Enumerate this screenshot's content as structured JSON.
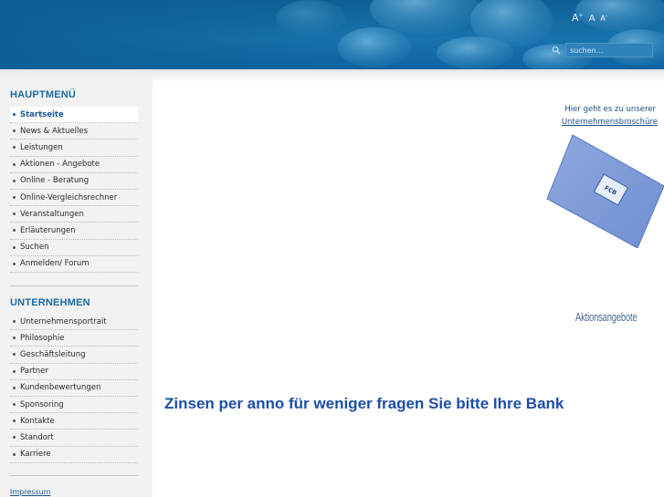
{
  "header": {
    "font_controls": {
      "increase": "A",
      "reset": "A",
      "decrease": "A"
    },
    "search": {
      "placeholder": "suchen..."
    }
  },
  "sidebar": {
    "main_menu_title": "HAUPTMENÜ",
    "main_menu": [
      {
        "label": "Startseite",
        "active": true
      },
      {
        "label": "News & Aktuelles"
      },
      {
        "label": "Leistungen"
      },
      {
        "label": "Aktionen - Angebote"
      },
      {
        "label": "Online - Beratung"
      },
      {
        "label": "Online-Vergleichsrechner"
      },
      {
        "label": "Veranstaltungen"
      },
      {
        "label": "Erläuterungen"
      },
      {
        "label": "Suchen"
      },
      {
        "label": "Anmelden/ Forum"
      }
    ],
    "company_menu_title": "UNTERNEHMEN",
    "company_menu": [
      {
        "label": "Unternehmensportrait"
      },
      {
        "label": "Philosophie"
      },
      {
        "label": "Geschäftsleitung"
      },
      {
        "label": "Partner"
      },
      {
        "label": "Kundenbewertungen"
      },
      {
        "label": "Sponsoring"
      },
      {
        "label": "Kontakte"
      },
      {
        "label": "Standort"
      },
      {
        "label": "Karriere"
      }
    ],
    "impressum": "Impressum"
  },
  "main": {
    "brochure_intro": "Hier geht es zu unserer",
    "brochure_link": "Unternehmensbroschüre",
    "brochure_logo_text": "FCB",
    "offers_link": "Aktionsangebote",
    "headline": "Zinsen per anno für weniger fragen Sie bitte Ihre Bank"
  },
  "colors": {
    "header_blue": "#1874ad",
    "accent_blue": "#1a6aa4",
    "headline_blue": "#1c4fa8",
    "sidebar_bg": "#f2f2f2"
  },
  "icons": [
    "search-icon"
  ]
}
